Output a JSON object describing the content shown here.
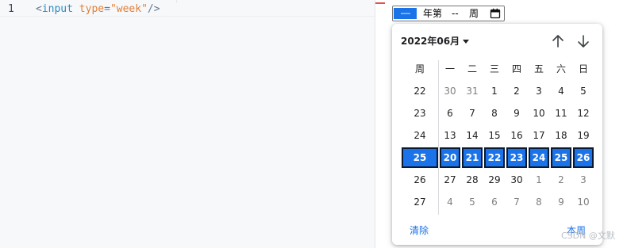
{
  "editor": {
    "line_number": "1",
    "code": {
      "open": "<",
      "tag": "input",
      "space": " ",
      "attr": "type",
      "eq": "=",
      "value": "\"week\"",
      "close": "/>"
    }
  },
  "week_input": {
    "year_placeholder": "----",
    "year_suffix": "年第",
    "week_placeholder": "--",
    "week_suffix": "周",
    "icon": "calendar-icon"
  },
  "calendar": {
    "month_label": "2022年06月",
    "nav_up_icon": "arrow-up-icon",
    "nav_down_icon": "arrow-down-icon",
    "week_col_header": "周",
    "weekdays": [
      "一",
      "二",
      "三",
      "四",
      "五",
      "六",
      "日"
    ],
    "rows": [
      {
        "week": "22",
        "days": [
          "30",
          "31",
          "1",
          "2",
          "3",
          "4",
          "5"
        ],
        "muted": [
          true,
          true,
          false,
          false,
          false,
          false,
          false
        ]
      },
      {
        "week": "23",
        "days": [
          "6",
          "7",
          "8",
          "9",
          "10",
          "11",
          "12"
        ],
        "muted": [
          false,
          false,
          false,
          false,
          false,
          false,
          false
        ]
      },
      {
        "week": "24",
        "days": [
          "13",
          "14",
          "15",
          "16",
          "17",
          "18",
          "19"
        ],
        "muted": [
          false,
          false,
          false,
          false,
          false,
          false,
          false
        ]
      },
      {
        "week": "25",
        "days": [
          "20",
          "21",
          "22",
          "23",
          "24",
          "25",
          "26"
        ],
        "muted": [
          false,
          false,
          false,
          false,
          false,
          false,
          false
        ],
        "selected": true
      },
      {
        "week": "26",
        "days": [
          "27",
          "28",
          "29",
          "30",
          "1",
          "2",
          "3"
        ],
        "muted": [
          false,
          false,
          false,
          false,
          true,
          true,
          true
        ]
      },
      {
        "week": "27",
        "days": [
          "4",
          "5",
          "6",
          "7",
          "8",
          "9",
          "10"
        ],
        "muted": [
          true,
          true,
          true,
          true,
          true,
          true,
          true
        ]
      }
    ],
    "clear_label": "清除",
    "this_week_label": "本周",
    "accent_color": "#1a73e8"
  },
  "watermark": "CSDN @文默"
}
